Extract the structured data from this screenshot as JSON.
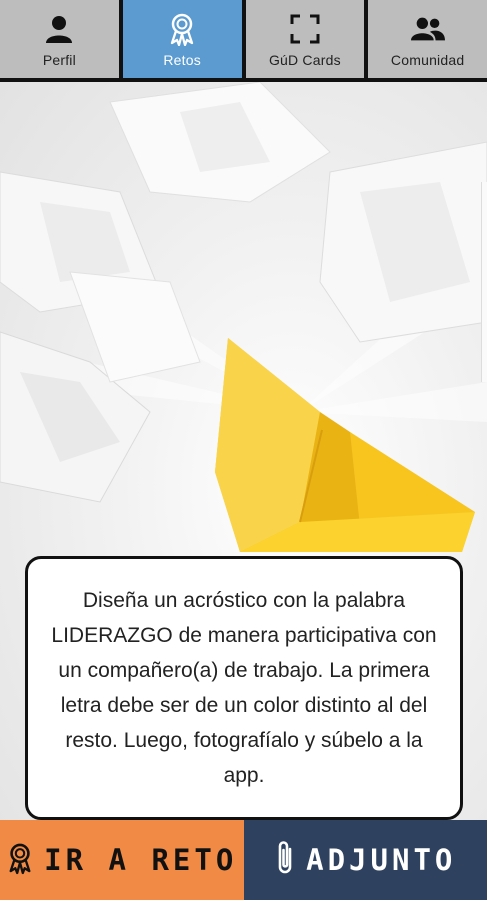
{
  "tabs": [
    {
      "label": "Perfil",
      "icon": "person-icon",
      "active": false
    },
    {
      "label": "Retos",
      "icon": "award-ribbon-icon",
      "active": true
    },
    {
      "label": "GúD Cards",
      "icon": "scan-frame-icon",
      "active": false
    },
    {
      "label": "Comunidad",
      "icon": "group-icon",
      "active": false
    }
  ],
  "challenge": {
    "text": "Diseña un acróstico con la palabra LIDERAZGO de manera participativa con un compañero(a) de trabajo. La primera letra debe ser de un color distinto al del resto. Luego, fotografíalo y súbelo a la app."
  },
  "actions": {
    "go_label": "IR A RETO",
    "go_icon": "award-ribbon-icon",
    "attach_label": "ADJUNTO",
    "attach_icon": "paperclip-icon"
  },
  "colors": {
    "tab_inactive": "#bdbdbd",
    "tab_active": "#5b9bd0",
    "go_button": "#f08a45",
    "attach_button": "#2e4260",
    "boat": "#f7c51e"
  }
}
